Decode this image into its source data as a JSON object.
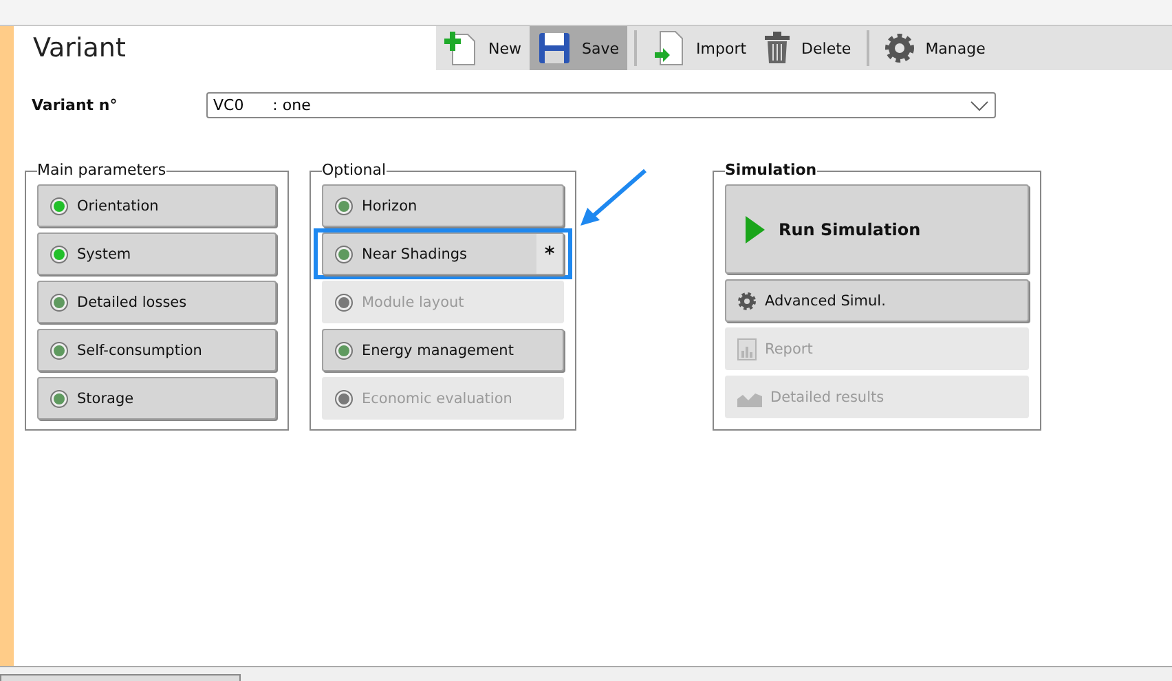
{
  "header": {
    "title": "Variant"
  },
  "toolbar": [
    {
      "label": "New",
      "kind": "new",
      "selected": false
    },
    {
      "label": "Save",
      "kind": "save",
      "selected": true
    },
    {
      "label": "Import",
      "kind": "import",
      "selected": false
    },
    {
      "label": "Delete",
      "kind": "delete",
      "selected": false
    },
    {
      "label": "Manage",
      "kind": "manage",
      "selected": false
    }
  ],
  "variant": {
    "label": "Variant n°",
    "value": "VC0      : one"
  },
  "main_parameters": {
    "title": "Main parameters",
    "items": [
      {
        "label": "Orientation",
        "done": true,
        "disabled": false
      },
      {
        "label": "System",
        "done": true,
        "disabled": false
      },
      {
        "label": "Detailed losses",
        "done": false,
        "disabled": false
      },
      {
        "label": "Self-consumption",
        "done": false,
        "disabled": false
      },
      {
        "label": "Storage",
        "done": false,
        "disabled": false
      }
    ]
  },
  "optional": {
    "title": "Optional",
    "items": [
      {
        "label": "Horizon",
        "done": false,
        "disabled": false,
        "highlighted": false
      },
      {
        "label": "Near Shadings",
        "done": false,
        "disabled": false,
        "highlighted": true,
        "badge": "*"
      },
      {
        "label": "Module layout",
        "done": false,
        "disabled": true,
        "highlighted": false
      },
      {
        "label": "Energy management",
        "done": false,
        "disabled": false,
        "highlighted": false
      },
      {
        "label": "Economic evaluation",
        "done": false,
        "disabled": true,
        "highlighted": false
      }
    ]
  },
  "simulation": {
    "title": "Simulation",
    "run": {
      "label": "Run Simulation",
      "disabled": false
    },
    "items": [
      {
        "label": "Advanced Simul.",
        "kind": "gear",
        "disabled": false
      },
      {
        "label": "Report",
        "kind": "report",
        "disabled": true
      },
      {
        "label": "Detailed results",
        "kind": "chart",
        "disabled": true
      }
    ]
  }
}
